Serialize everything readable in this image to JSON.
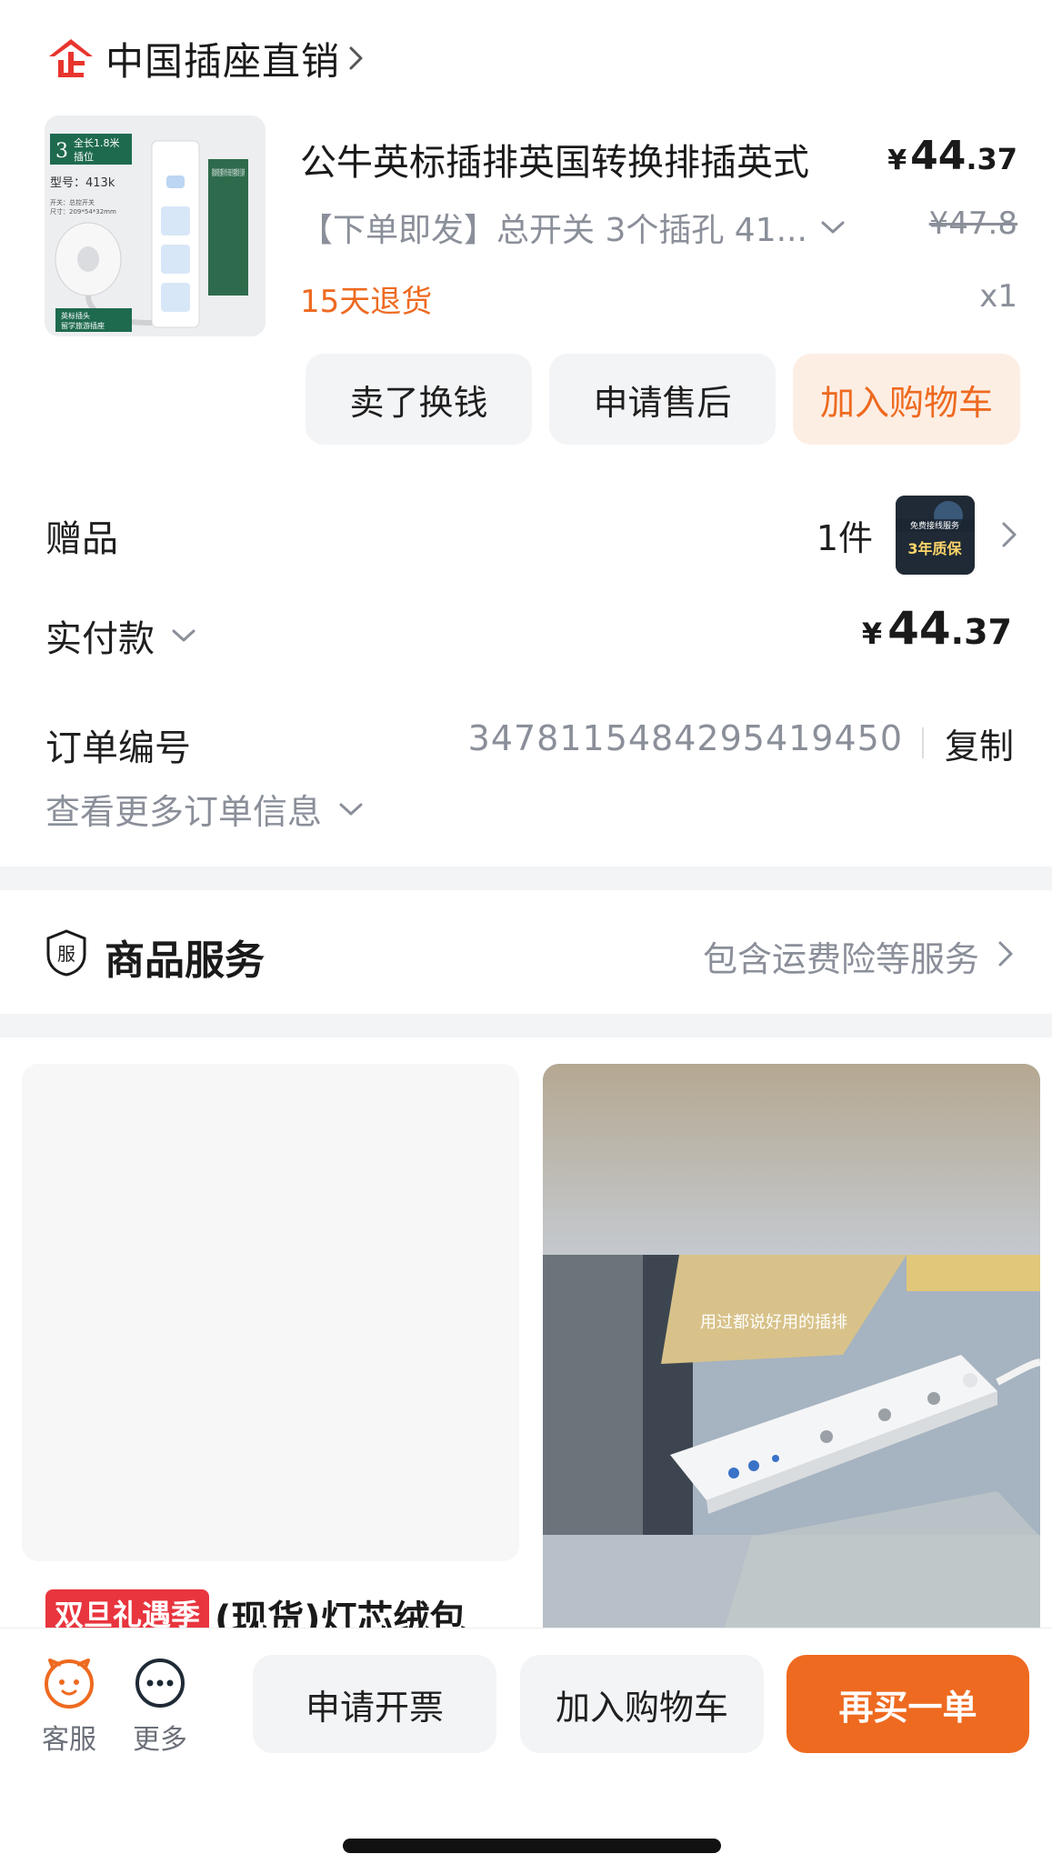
{
  "store": {
    "name": "中国插座直销",
    "logo_icon": "enterprise-logo-icon",
    "brand_color": "#e8352e"
  },
  "product": {
    "title": "公牛英标插排英国转换排插英式",
    "price_symbol": "¥",
    "price_integer": "44",
    "price_decimal": ".37",
    "spec": "【下单即发】总开关 3个插孔 41...",
    "original_price": "¥47.8",
    "return_policy": "15天退货",
    "quantity": "x1",
    "thumb_texts": {
      "length_num": "3",
      "length_text": "全长1.8米",
      "outlet_text": "插位",
      "model": "型号：413k",
      "spec_line1": "开关：总控开关",
      "spec_line2": "尺寸：209*54*32mm",
      "caption_line1": "英标插头",
      "caption_line2": "留学旅游插座",
      "countries": "英国 新加坡 阿联酋 巴基斯坦 马尔代夫 马来西亚 巴林 塞普勒斯 文莱 也门 越南 等"
    }
  },
  "actions": {
    "sell": "卖了换钱",
    "after_sale": "申请售后",
    "add_cart": "加入购物车"
  },
  "gift": {
    "label": "赠品",
    "count": "1件",
    "thumb_line1": "免费接线服务",
    "thumb_line2": "3年质保"
  },
  "paid": {
    "label": "实付款",
    "symbol": "¥",
    "integer": "44",
    "decimal": ".37"
  },
  "order": {
    "label": "订单编号",
    "number": "3478115484295419450",
    "copy": "复制",
    "more": "查看更多订单信息"
  },
  "service": {
    "badge": "服",
    "title": "商品服务",
    "desc": "包含运费险等服务"
  },
  "recommend": {
    "tag": "双旦礼遇季",
    "title": "(现货)灯芯绒包",
    "video_caption": "用过都说好用的插排"
  },
  "bottom": {
    "service_label": "客服",
    "more_label": "更多",
    "invoice": "申请开票",
    "add_cart": "加入购物车",
    "rebuy": "再买一单"
  },
  "colors": {
    "accent_orange": "#ee6a20",
    "accent_orange_light": "#fdeee4",
    "sale_red": "#e8353e",
    "muted_gray": "#8a8f99",
    "button_gray": "#f3f4f6"
  }
}
